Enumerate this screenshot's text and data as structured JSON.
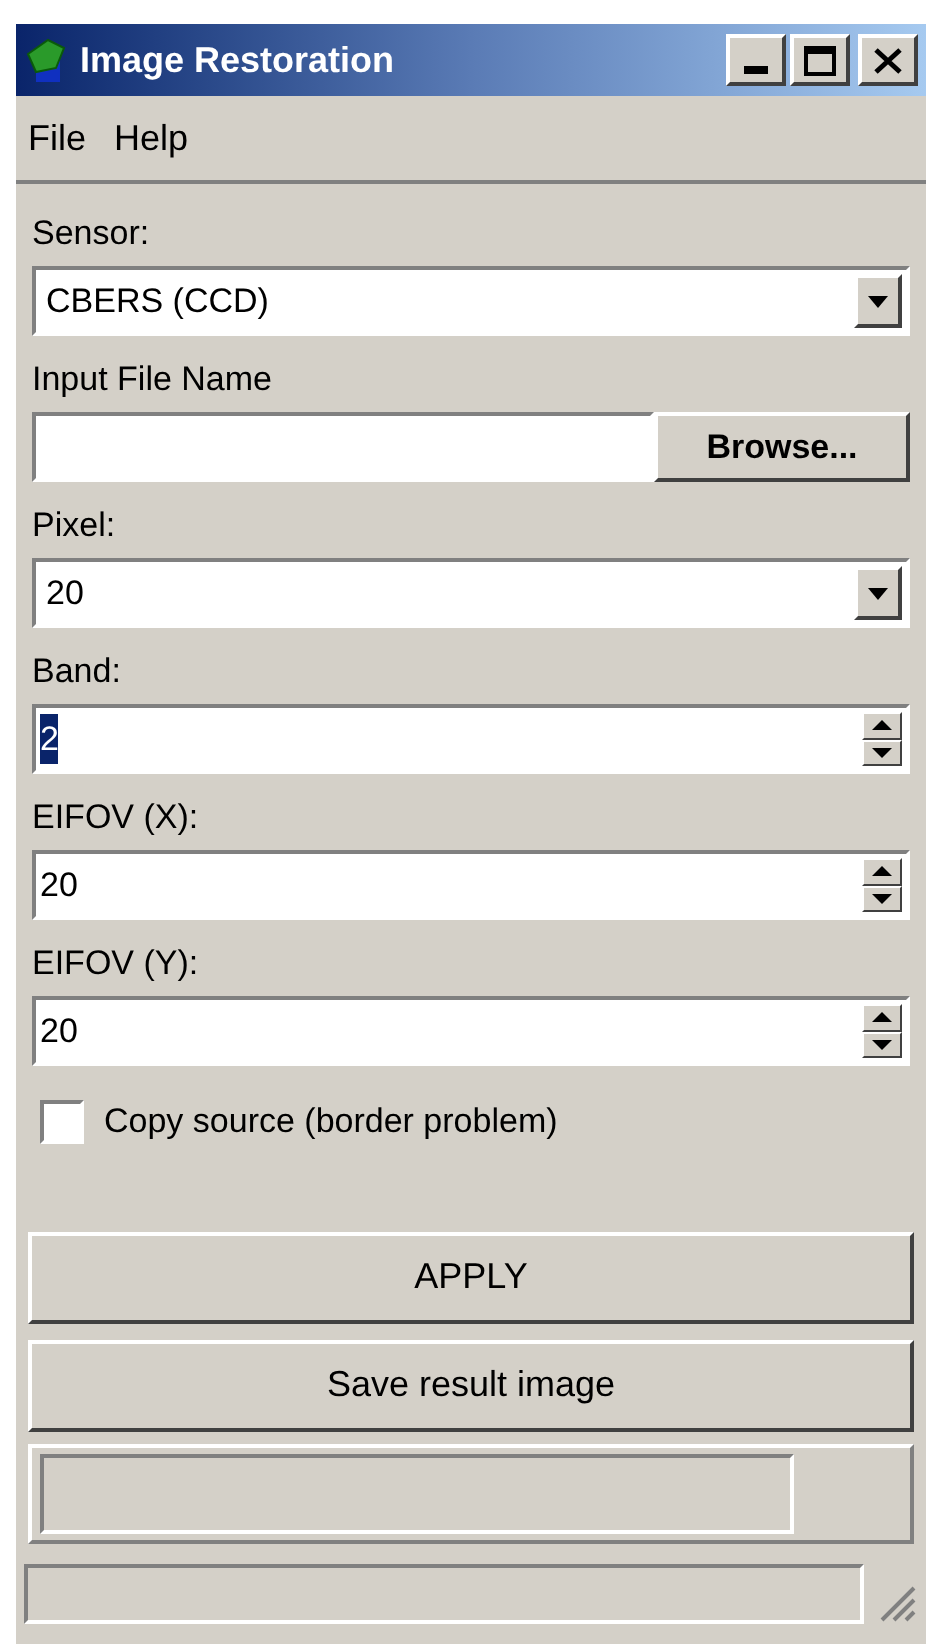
{
  "window": {
    "title": "Image Restoration"
  },
  "menu": [
    {
      "label": "File"
    },
    {
      "label": "Help"
    }
  ],
  "fields": [
    {
      "label": "Sensor:",
      "kind": "combo",
      "value": "CBERS (CCD)"
    },
    {
      "label": "Input File Name",
      "kind": "file",
      "button": "Browse..."
    },
    {
      "label": "Pixel:",
      "kind": "combo",
      "value": "20"
    },
    {
      "label": "Band:",
      "kind": "spin",
      "value": "2",
      "text_selected": true
    },
    {
      "label": "EIFOV (X):",
      "kind": "spin",
      "value": "20",
      "text_selected": false
    },
    {
      "label": "EIFOV (Y):",
      "kind": "spin",
      "value": "20",
      "text_selected": false
    }
  ],
  "checkbox": {
    "label": "Copy source (border problem)",
    "checked": false
  },
  "buttons": [
    "APPLY",
    "Save result image"
  ]
}
